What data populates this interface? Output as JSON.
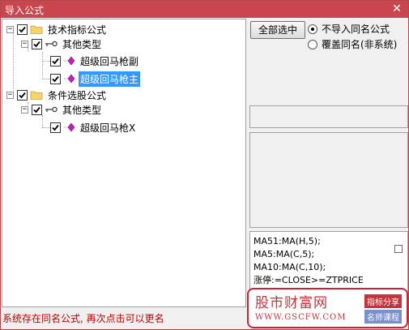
{
  "window": {
    "title": "导入公式",
    "close_glyph": "✕",
    "titlebar_color": "#c9464f"
  },
  "tree": {
    "nodes": [
      {
        "label": "技术指标公式",
        "checked": true,
        "expanded": true,
        "icon": "folder-icon"
      },
      {
        "label": "其他类型",
        "checked": true,
        "expanded": true,
        "icon": "key-icon"
      },
      {
        "label": "超级回马枪副",
        "checked": true,
        "icon": "gem-icon"
      },
      {
        "label": "超级回马枪主",
        "checked": true,
        "icon": "gem-icon",
        "selected": true
      },
      {
        "label": "条件选股公式",
        "checked": true,
        "expanded": true,
        "icon": "folder-icon"
      },
      {
        "label": "其他类型",
        "checked": true,
        "expanded": true,
        "icon": "key-icon"
      },
      {
        "label": "超级回马枪X",
        "checked": true,
        "icon": "gem-icon"
      }
    ],
    "collapse_glyph": "−"
  },
  "controls": {
    "select_all_label": "全部选中",
    "radio_no_import": "不导入同名公式",
    "radio_overwrite": "覆盖同名(非系统)",
    "selected_radio": "no_import"
  },
  "code": {
    "lines": [
      "MA51:MA(H,5);",
      "MA5:MA(C,5);",
      "MA10:MA(C,10);",
      "涨停:=CLOSE>=ZTPRICE"
    ]
  },
  "status": {
    "message": "系统存在同名公式, 再次点击可以更名",
    "color": "#c00000"
  },
  "watermark": {
    "title": "股市财富网",
    "url": "WWW.GSCFW.COM",
    "tag1": "指标分享",
    "tag2": "名师课程",
    "accent": "#c8323c"
  }
}
